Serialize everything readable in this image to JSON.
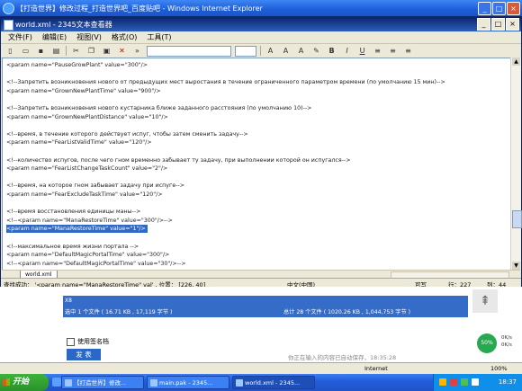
{
  "ie": {
    "title": "【打造世界】修改过程_打造世界吧_百度贴吧 - Windows Internet Explorer",
    "controls": [
      "_",
      "□",
      "×"
    ]
  },
  "editor": {
    "title": "world.xml - 2345文本查看器",
    "menu": [
      "文件(F)",
      "编辑(E)",
      "视图(V)",
      "格式(O)",
      "工具(T)"
    ],
    "lines": [
      "<param name=\"PauseGrowPlant\" value=\"300\"/>",
      "",
      "<!--Запретить возникновения нового от предыдущих мест выростания в течение ограниченного параметром времени (по умолчанию 15 мин)-->",
      "<param name=\"GrownNewPlantTime\" value=\"900\"/>",
      "",
      "<!--Запретить возникновения нового кустарника ближе заданного расстояния (по умолчанию 10)-->",
      "<param name=\"GrownNewPlantDistance\" value=\"10\"/>",
      "",
      "<!--время, в течение которого действует испуг, чтобы затем сменить задачу-->",
      "<param name=\"FearListValidTime\" value=\"120\"/>",
      "",
      "<!--количество испугов, после чего гном временно забывает ту задачу, при выполнении которой он испугался-->",
      "<param name=\"FearListChangeTaskCount\" value=\"2\"/>",
      "",
      "<!--время, на которое гном забывает задачу при испуге-->",
      "<param name=\"FearExcludeTaskTime\" value=\"120\"/>",
      "",
      "<!--время восстановления единицы маны-->",
      "<!--<param name=\"ManaRestoreTime\" value=\"300\"/>-->",
      "<param name=\"ManaRestoreTime\" value=\"1\"/>",
      "",
      "<!--максимальное время жизни портала -->",
      "<param name=\"DefaultMagicPortalTime\" value=\"300\"/>",
      "<!--<param name=\"DefaultMagicPortalTime\" value=\"30\"/>-->"
    ],
    "highlighted_line": 19,
    "tab": "world.xml",
    "status": {
      "find": "查找成功： '<param name=\"ManaRestoreTime\" val' , 位置： [226, 40]",
      "encoding": "中文(中国)",
      "writable": "可写",
      "line": "行：227",
      "column": "列：44"
    }
  },
  "page": {
    "file_marker": "X8",
    "selected_info": "选中 1 个文件 ( 16.71 KB , 17,119 字节 )",
    "total_info": "总计 28 个文件 ( 1020.26 KB , 1,044,753 字节 )",
    "signature_label": "使用签名档",
    "send_label": "发 表",
    "autosave_text": "你正在输入的内容已自动保存，18:35:28",
    "gauge": {
      "percent": "50%",
      "stats": [
        "0K/s",
        "0K/s"
      ]
    }
  },
  "ie_status": {
    "zone": "Internet",
    "zoom": "100%"
  },
  "taskbar": {
    "start": "开始",
    "tasks": [
      "【打造世界】修改...",
      "main.pak - 2345...",
      "world.xml - 2345..."
    ],
    "clock": "18:37"
  }
}
